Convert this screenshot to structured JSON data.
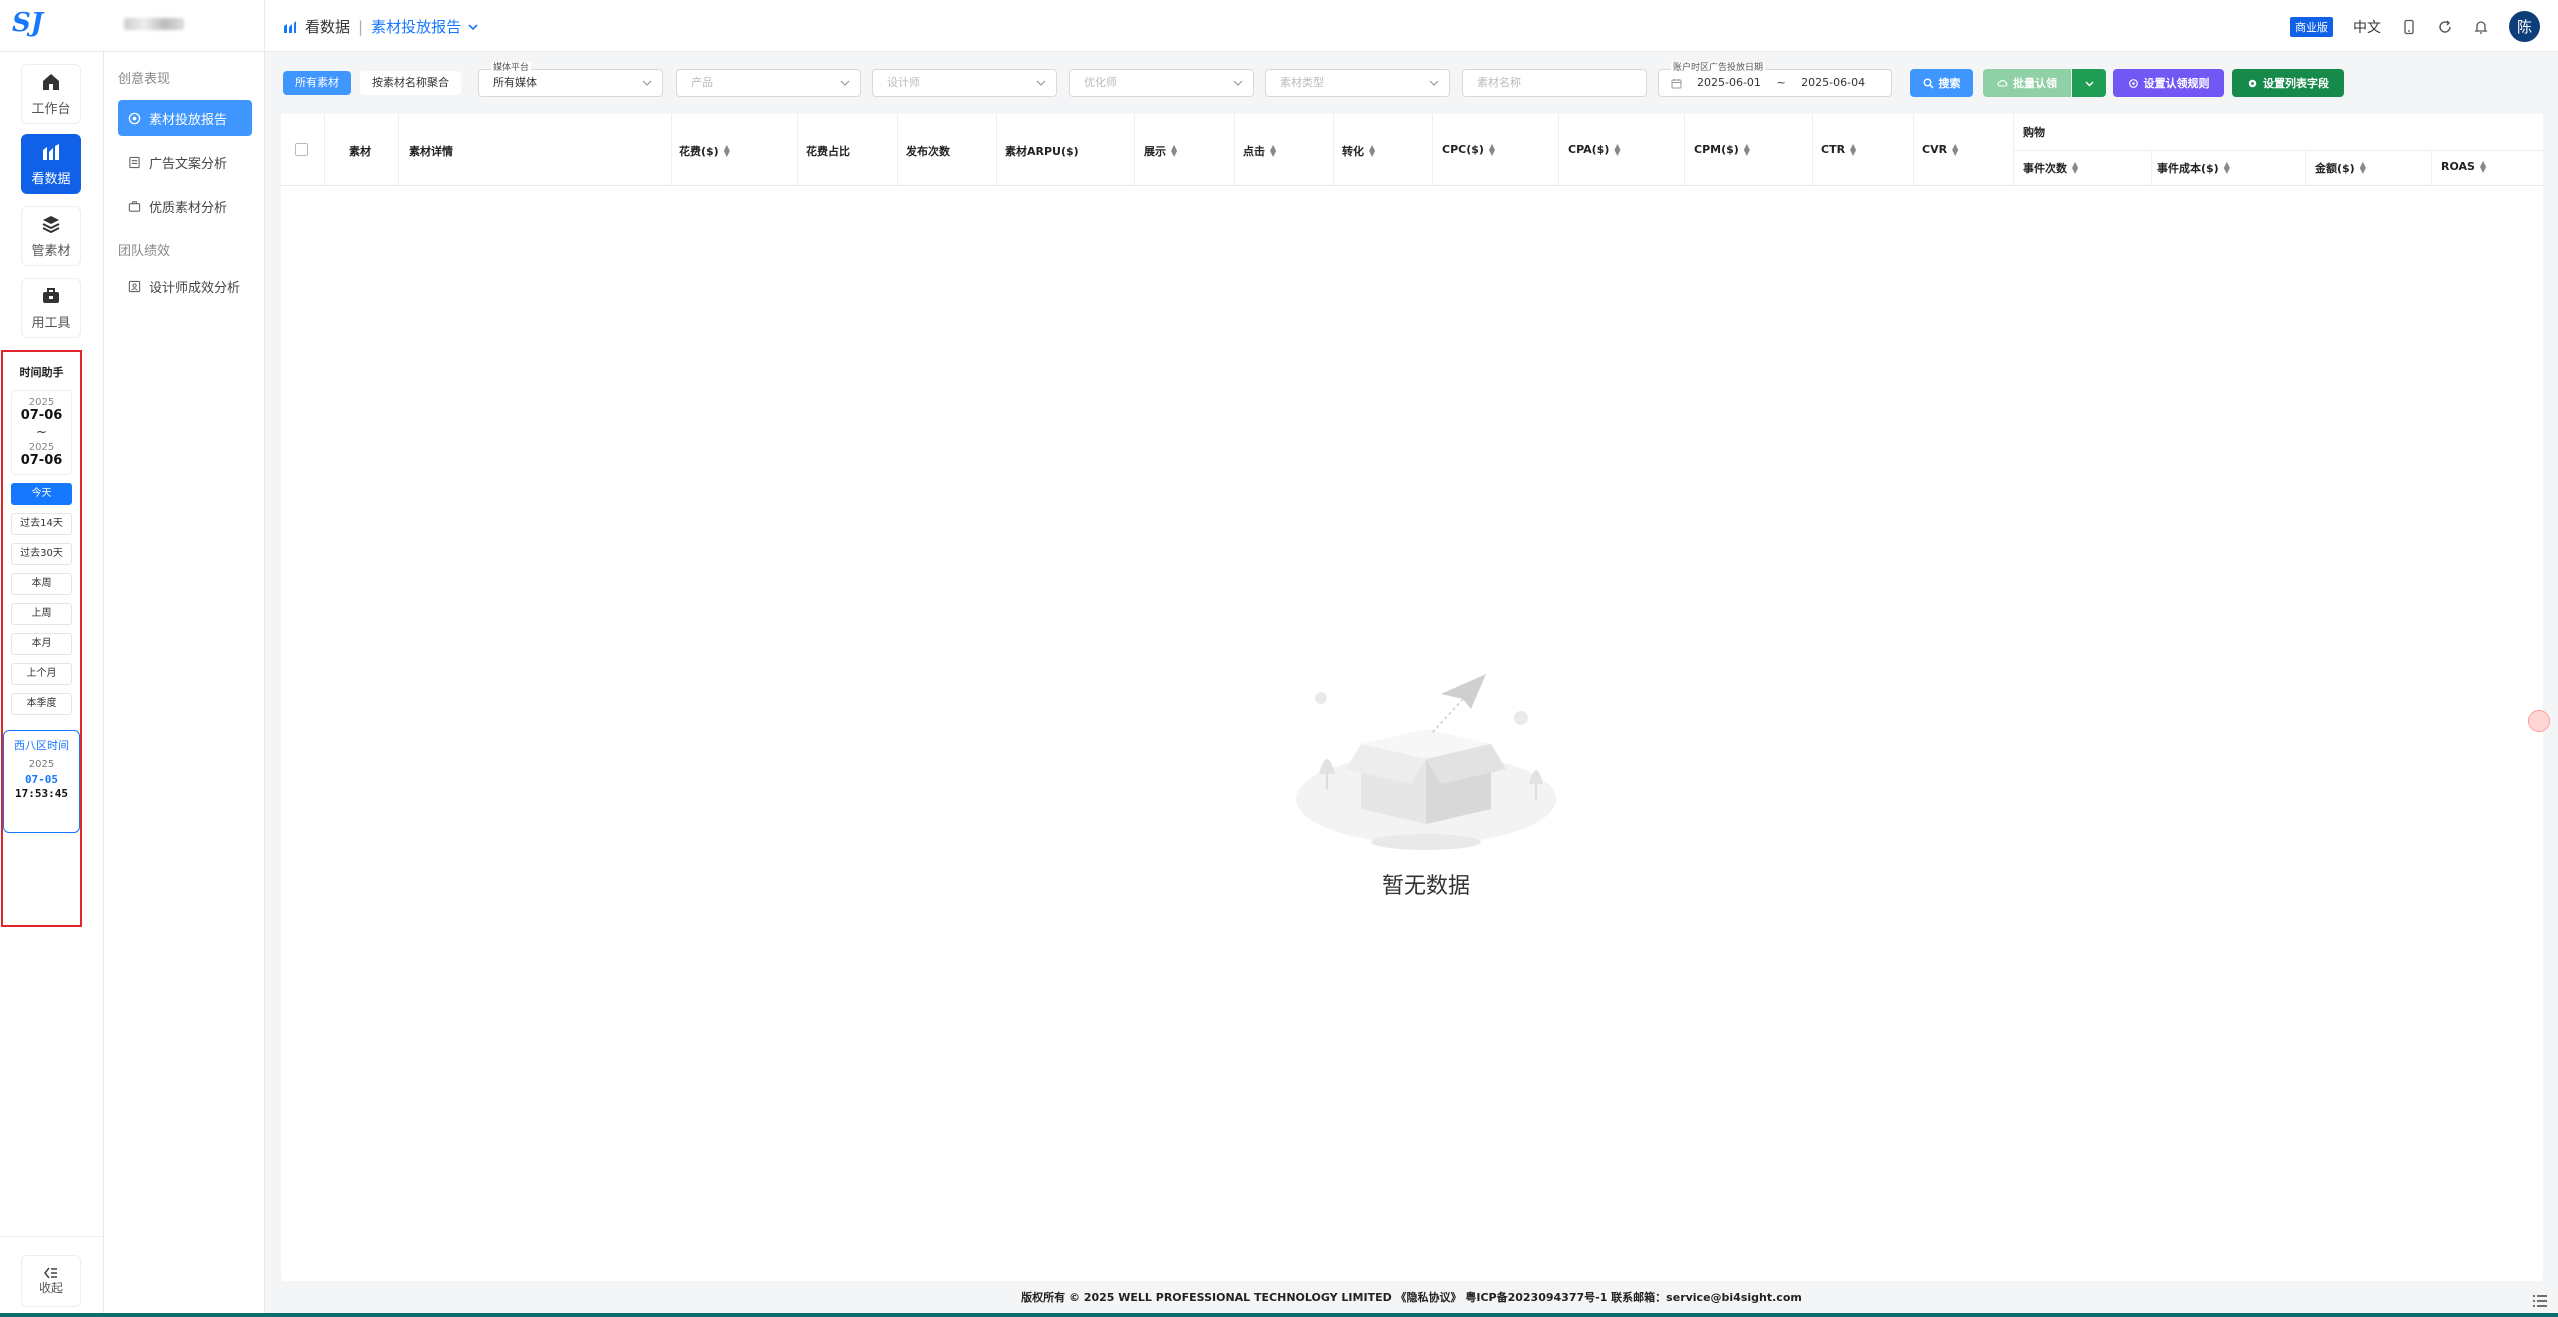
{
  "logo": {
    "text": "SJ"
  },
  "rail": {
    "items": [
      {
        "label": "工作台",
        "icon": "home-icon"
      },
      {
        "label": "看数据",
        "icon": "chart-icon"
      },
      {
        "label": "管素材",
        "icon": "layers-icon"
      },
      {
        "label": "用工具",
        "icon": "toolbox-icon"
      }
    ],
    "collapse_label": "收起"
  },
  "time_helper": {
    "title": "时间助手",
    "start_year": "2025",
    "start_date": "07-06",
    "tilde": "~",
    "end_year": "2025",
    "end_date": "07-06",
    "buttons": [
      "今天",
      "过去14天",
      "过去30天",
      "本周",
      "上周",
      "本月",
      "上个月",
      "本季度"
    ],
    "tz_title": "西八区时间",
    "tz_year": "2025",
    "tz_date": "07-05",
    "tz_time": "17:53:45"
  },
  "submenu": {
    "group1": "创意表现",
    "items1": [
      "素材投放报告",
      "广告文案分析",
      "优质素材分析"
    ],
    "group2": "团队绩效",
    "items2": [
      "设计师成效分析"
    ]
  },
  "header": {
    "crumb1": "看数据",
    "sep": "|",
    "crumb2": "素材投放报告",
    "pro": "商业版",
    "lang": "中文",
    "avatar": "陈"
  },
  "filters": {
    "tab_all": "所有素材",
    "tab_name": "按素材名称聚合",
    "platform_label": "媒体平台",
    "platform_value": "所有媒体",
    "product": "产品",
    "designer": "设计师",
    "optimizer": "优化师",
    "material_type": "素材类型",
    "material_name": "素材名称",
    "date_label": "账户时区广告投放日期",
    "date_start": "2025-06-01",
    "date_tilde": "~",
    "date_end": "2025-06-04",
    "search": "搜索",
    "batch": "批量认领",
    "claim_rule": "设置认领规则",
    "columns": "设置列表字段"
  },
  "table": {
    "headers": [
      "素材",
      "素材详情",
      "花费($)",
      "花费占比",
      "发布次数",
      "素材ARPU($)",
      "展示",
      "点击",
      "转化",
      "CPC($)",
      "CPA($)",
      "CPM($)",
      "CTR",
      "CVR"
    ],
    "group": "购物",
    "sub_headers": [
      "事件次数",
      "事件成本($)",
      "金额($)",
      "ROAS"
    ],
    "empty": "暂无数据"
  },
  "footer": "版权所有 © 2025 WELL PROFESSIONAL TECHNOLOGY LIMITED 《隐私协议》 粤ICP备2023094377号-1 联系邮箱：service@bi4sight.com",
  "colors": {
    "primary": "#1677ff",
    "active_rail": "#1160e8",
    "green": "#1f9d55",
    "purple": "#7357f5",
    "dark_green": "#168a4a",
    "red_border": "#e0252b"
  }
}
